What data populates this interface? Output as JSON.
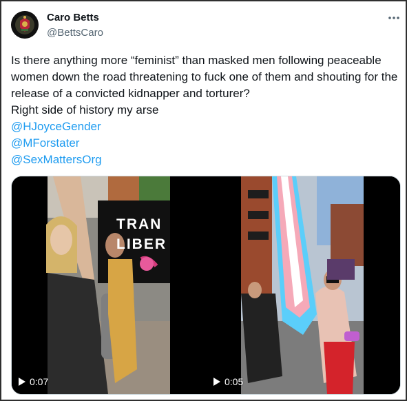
{
  "author": {
    "display_name": "Caro Betts",
    "handle": "@BettsCaro"
  },
  "tweet": {
    "paragraph": "Is there anything more “feminist” than masked men following peaceable women down the road threatening to fuck one of them and shouting for the release of a convicted kidnapper and torturer?",
    "line2": "Right side of history my arse",
    "mentions": [
      "@HJoyceGender",
      "@MForstater",
      "@SexMattersOrg"
    ]
  },
  "media": {
    "videos": [
      {
        "duration": "0:07",
        "banner_text": [
          "TRAN",
          "LIBER"
        ]
      },
      {
        "duration": "0:05"
      }
    ]
  },
  "colors": {
    "link": "#1d9bf0",
    "text": "#0f1419",
    "secondary": "#536471",
    "trans_blue": "#5bcefa",
    "trans_pink": "#f5a9b8"
  }
}
